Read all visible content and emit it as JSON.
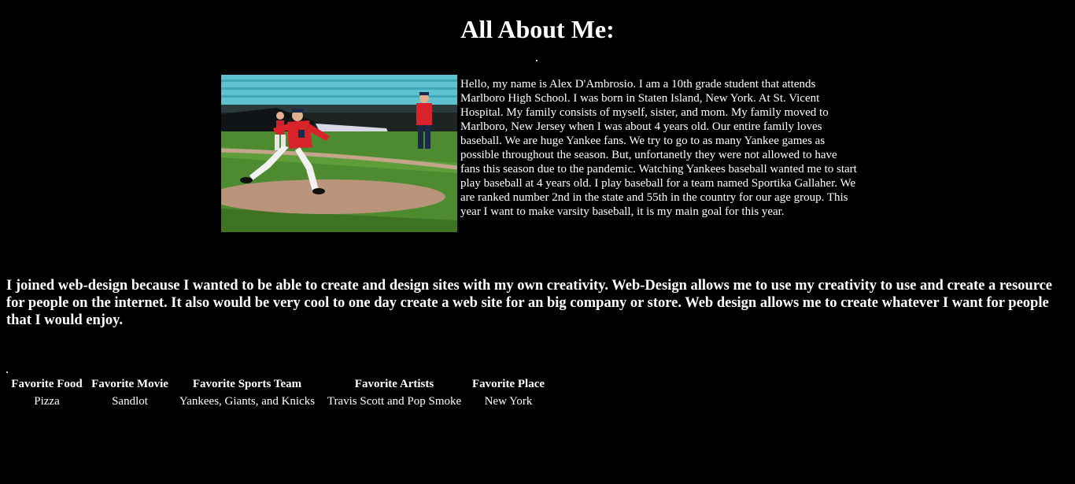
{
  "page": {
    "title": "All About Me:"
  },
  "photo": {
    "icon": "baseball-pitcher-photo",
    "colors": {
      "sky_seats": "#5ec3cf",
      "grass": "#4e8a2f",
      "dirt": "#b9937a",
      "jersey": "#d8232a"
    }
  },
  "bio": {
    "text": "Hello, my name is Alex D'Ambrosio. I am a 10th grade student that attends Marlboro High School. I was born in Staten Island, New York. At St. Vicent Hospital. My family consists of myself, sister, and mom. My family moved to Marlboro, New Jersey when I was about 4 years old. Our entire family loves baseball. We are huge Yankee fans. We try to go to as many Yankee games as possible throughout the season. But, unfortanetly they were not allowed to have fans this season due to the pandemic. Watching Yankees baseball wanted me to start play baseball at 4 years old. I play baseball for a team named Sportika Gallaher. We are ranked number 2nd in the state and 55th in the country for our age group. This year I want to make varsity baseball, it is my main goal for this year."
  },
  "about": {
    "text": "I joined web-design because I wanted to be able to create and design sites with my own creativity. Web-Design allows me to use my creativity to use and create a resource for people on the internet. It also would be very cool to one day create a web site for an big company or store. Web design allows me to create whatever I want for people that I would enjoy."
  },
  "favorites": {
    "headers": [
      "Favorite Food",
      "Favorite Movie",
      "Favorite Sports Team",
      "Favorite Artists",
      "Favorite Place"
    ],
    "values": [
      "Pizza",
      "Sandlot",
      "Yankees, Giants, and Knicks",
      "Travis Scott and Pop Smoke",
      "New York"
    ]
  }
}
